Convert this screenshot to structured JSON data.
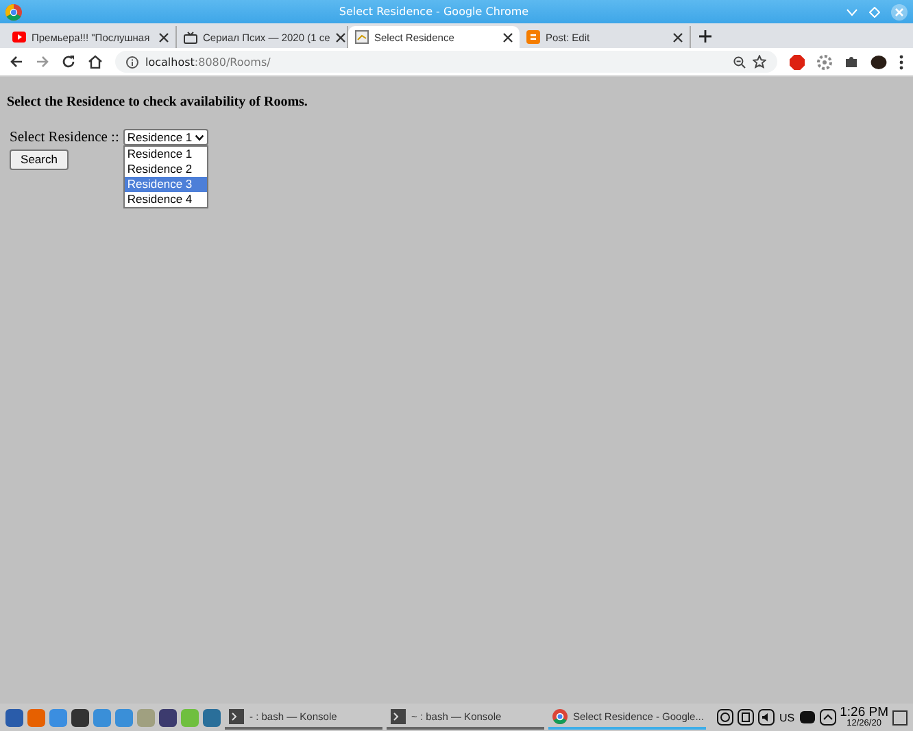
{
  "window": {
    "title": "Select Residence - Google Chrome"
  },
  "tabs": [
    {
      "label": "Премьера!!! \"Послушная",
      "selected": false,
      "kind": "video"
    },
    {
      "label": "Сериал Псих — 2020 (1 се",
      "selected": false,
      "kind": "tv"
    },
    {
      "label": "Select Residence",
      "selected": true,
      "kind": "page"
    },
    {
      "label": "Post: Edit",
      "selected": false,
      "kind": "blog"
    }
  ],
  "address": {
    "host": "localhost",
    "path": ":8080/Rooms/"
  },
  "page": {
    "heading": "Select the Residence to check availability of Rooms.",
    "label": "Select Residence ::",
    "select_value": "Residence 1",
    "options": [
      {
        "label": "Residence 1",
        "selected": false
      },
      {
        "label": "Residence 2",
        "selected": false
      },
      {
        "label": "Residence 3",
        "selected": true
      },
      {
        "label": "Residence 4",
        "selected": false
      }
    ],
    "button": "Search"
  },
  "taskbar": {
    "tasks": [
      {
        "label": "- : bash — Konsole",
        "selected": false,
        "kind": "terminal"
      },
      {
        "label": "~ : bash — Konsole",
        "selected": false,
        "kind": "terminal"
      },
      {
        "label": "Select Residence - Google...",
        "selected": true,
        "kind": "browser"
      }
    ],
    "keyboard": "US",
    "time": "1:26 PM",
    "date": "12/26/20"
  }
}
